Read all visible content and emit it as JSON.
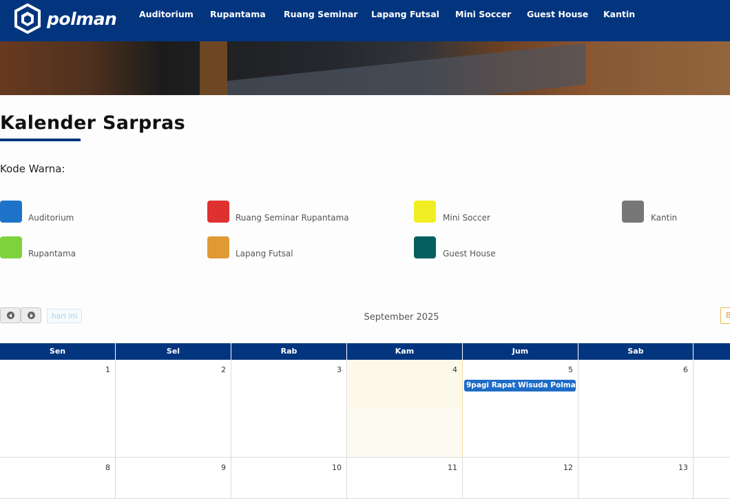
{
  "brand": {
    "name": "polman"
  },
  "nav": {
    "items": [
      "Auditorium",
      "Rupantama",
      "Ruang Seminar",
      "Lapang Futsal",
      "Mini Soccer",
      "Guest House",
      "Kantin"
    ]
  },
  "page": {
    "title": "Kalender Sarpras",
    "legend_heading": "Kode Warna:"
  },
  "legend": [
    {
      "label": "Auditorium",
      "color": "#1e73c8"
    },
    {
      "label": "Ruang Seminar Rupantama",
      "color": "#e03131"
    },
    {
      "label": "Mini Soccer",
      "color": "#f0ee23"
    },
    {
      "label": "Kantin",
      "color": "#777777"
    },
    {
      "label": "Rupantama",
      "color": "#7ed33c"
    },
    {
      "label": "Lapang Futsal",
      "color": "#e09a33"
    },
    {
      "label": "Guest House",
      "color": "#055f5f"
    }
  ],
  "calendar": {
    "today_button": "hari ini",
    "month": "September 2025",
    "view_button": "B",
    "weekdays": [
      "Sen",
      "Sel",
      "Rab",
      "Kam",
      "Jum",
      "Sab",
      ""
    ],
    "weeks": [
      [
        "1",
        "2",
        "3",
        "4",
        "5",
        "6",
        ""
      ],
      [
        "8",
        "9",
        "10",
        "11",
        "12",
        "13",
        ""
      ]
    ],
    "today": "4",
    "events": [
      {
        "time": "9pagi",
        "title": "Rapat Wisuda Polman Tah",
        "day": "5",
        "color": "#1e6cc7"
      }
    ]
  }
}
